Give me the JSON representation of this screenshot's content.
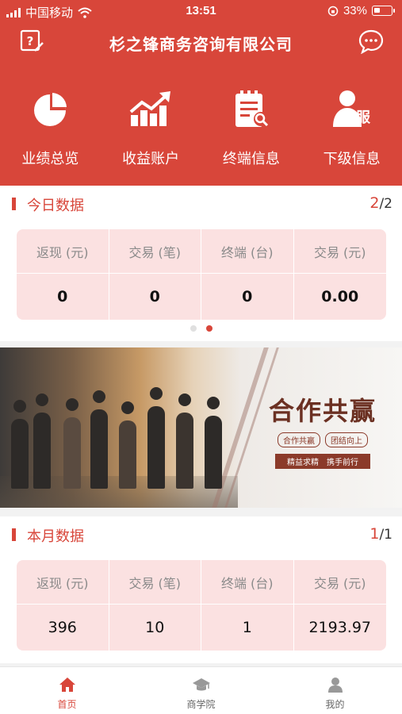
{
  "status_bar": {
    "carrier": "中国移动",
    "time": "13:51",
    "battery": "33%"
  },
  "header": {
    "title": "杉之锋商务咨询有限公司"
  },
  "quick_actions": [
    {
      "label": "业绩总览",
      "icon": "pie-chart-icon"
    },
    {
      "label": "收益账户",
      "icon": "growth-chart-icon"
    },
    {
      "label": "终端信息",
      "icon": "terminal-clipboard-icon"
    },
    {
      "label": "下级信息",
      "icon": "subordinate-user-icon",
      "icon_text": "服"
    }
  ],
  "today": {
    "title": "今日数据",
    "page_current": "2",
    "page_total": "/2",
    "headers": [
      "返现 (元)",
      "交易 (笔)",
      "终端 (台)",
      "交易 (元)"
    ],
    "values": [
      "0",
      "0",
      "0",
      "0.00"
    ]
  },
  "carousel": {
    "count": 2,
    "active_index": 1
  },
  "banner": {
    "slogan": "合作共赢",
    "tags": [
      "合作共赢",
      "团结向上"
    ],
    "sub": "精益求精　携手前行"
  },
  "month": {
    "title": "本月数据",
    "page_current": "1",
    "page_total": "/1",
    "headers": [
      "返现 (元)",
      "交易 (笔)",
      "终端 (台)",
      "交易 (元)"
    ],
    "values": [
      "396",
      "10",
      "1",
      "2193.97"
    ]
  },
  "tabs": [
    {
      "label": "首页",
      "icon": "home-icon",
      "active": true
    },
    {
      "label": "商学院",
      "icon": "graduation-cap-icon",
      "active": false
    },
    {
      "label": "我的",
      "icon": "user-icon",
      "active": false
    }
  ],
  "colors": {
    "primary": "#d8463a",
    "cell_bg": "#fbe1e1"
  }
}
